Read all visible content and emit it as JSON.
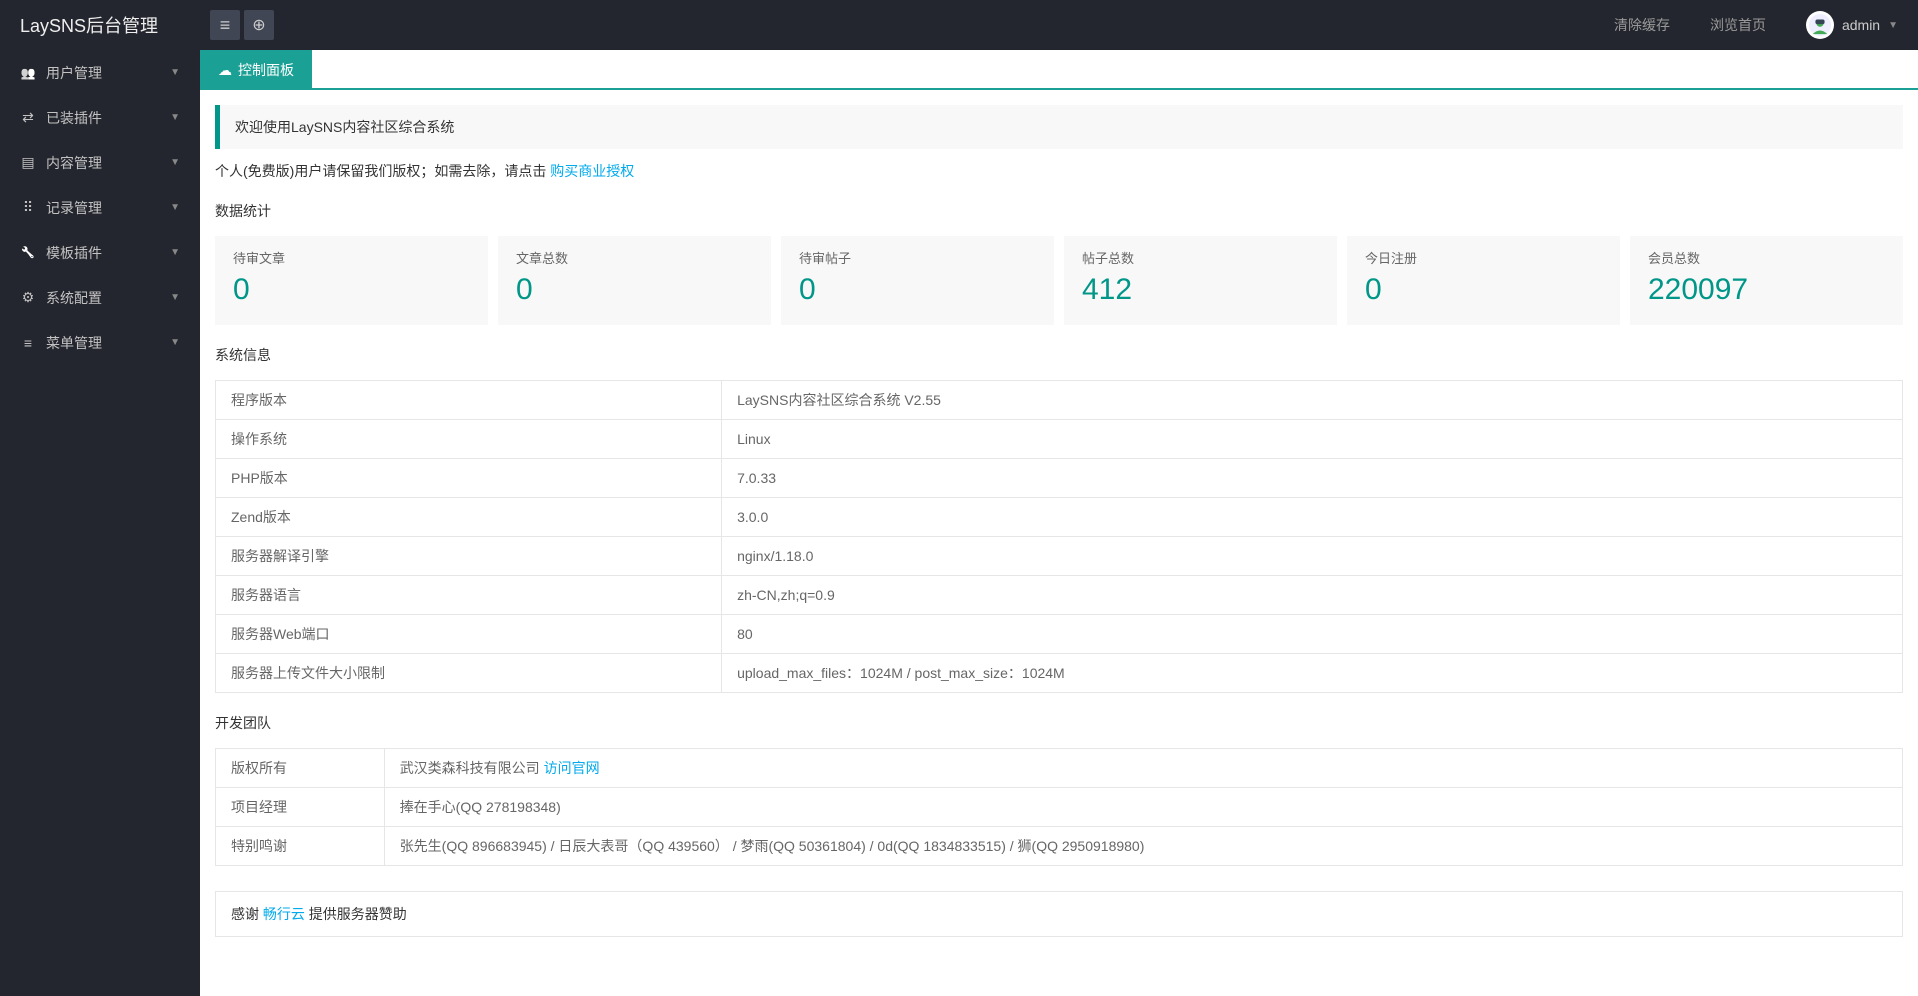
{
  "header": {
    "logo": "LaySNS后台管理",
    "clear_cache": "清除缓存",
    "preview": "浏览首页",
    "username": "admin"
  },
  "sidebar": {
    "items": [
      {
        "label": "用户管理",
        "icon": "i-users"
      },
      {
        "label": "已装插件",
        "icon": "i-plugin"
      },
      {
        "label": "内容管理",
        "icon": "i-doc"
      },
      {
        "label": "记录管理",
        "icon": "i-record"
      },
      {
        "label": "模板插件",
        "icon": "i-template"
      },
      {
        "label": "系统配置",
        "icon": "i-config"
      },
      {
        "label": "菜单管理",
        "icon": "i-menumgr"
      }
    ]
  },
  "tab": {
    "label": "控制面板"
  },
  "welcome": "欢迎使用LaySNS内容社区综合系统",
  "subtext_prefix": "个人(免费版)用户请保留我们版权；如需去除，请点击 ",
  "subtext_link": "购买商业授权",
  "sections": {
    "stats_title": "数据统计",
    "sysinfo_title": "系统信息",
    "team_title": "开发团队"
  },
  "stats": [
    {
      "label": "待审文章",
      "value": "0"
    },
    {
      "label": "文章总数",
      "value": "0"
    },
    {
      "label": "待审帖子",
      "value": "0"
    },
    {
      "label": "帖子总数",
      "value": "412"
    },
    {
      "label": "今日注册",
      "value": "0"
    },
    {
      "label": "会员总数",
      "value": "220097"
    }
  ],
  "sysinfo": [
    {
      "k": "程序版本",
      "v": "LaySNS内容社区综合系统 V2.55"
    },
    {
      "k": "操作系统",
      "v": "Linux"
    },
    {
      "k": "PHP版本",
      "v": "7.0.33"
    },
    {
      "k": "Zend版本",
      "v": "3.0.0"
    },
    {
      "k": "服务器解译引擎",
      "v": "nginx/1.18.0"
    },
    {
      "k": "服务器语言",
      "v": "zh-CN,zh;q=0.9"
    },
    {
      "k": "服务器Web端口",
      "v": "80"
    },
    {
      "k": "服务器上传文件大小限制",
      "v": "upload_max_files：1024M / post_max_size：1024M"
    }
  ],
  "team": [
    {
      "k": "版权所有",
      "v_prefix": "武汉类森科技有限公司 ",
      "v_link": "访问官网",
      "v_suffix": ""
    },
    {
      "k": "项目经理",
      "v_prefix": "捧在手心(QQ 278198348)",
      "v_link": "",
      "v_suffix": ""
    },
    {
      "k": "特别鸣谢",
      "v_prefix": "张先生(QQ 896683945) / 日辰大表哥（QQ 439560） / 梦雨(QQ 50361804) / 0d(QQ 1834833515) / 狮(QQ 2950918980)",
      "v_link": "",
      "v_suffix": ""
    }
  ],
  "thanks": {
    "prefix": "感谢 ",
    "link": "畅行云",
    "suffix": " 提供服务器赞助"
  }
}
